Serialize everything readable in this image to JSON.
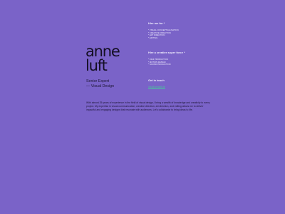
{
  "logo": {
    "line1": "anne",
    "line2": "luft"
  },
  "role": {
    "line1": "Senior Expert",
    "line2": "— Visual Design"
  },
  "intro": "With almost 25 years of experience in the field of visual design, I bring a wealth of knowledge and creativity to every project. My expertise in visual communication, creative direction, art direction, and editing allows me to deliver impactful and engaging designs that resonate with audiences. Let's collaborate to bring ideas to life.",
  "hire_me_for": {
    "title": "Hire me for *",
    "items": [
      "* VISUAL CONCEPTUALISATION",
      "* CREATIVE DIRECTION",
      "* ART DIRECTION",
      "* EDITING"
    ]
  },
  "superforce": {
    "title": "Hire a creative super force *",
    "items": [
      "* FILM PRODUCTION",
      "* MOTION DESIGN",
      "* SOUND PRODUCTION"
    ]
  },
  "contact": {
    "title": "Get in touch",
    "email": "info@annluft.de"
  }
}
